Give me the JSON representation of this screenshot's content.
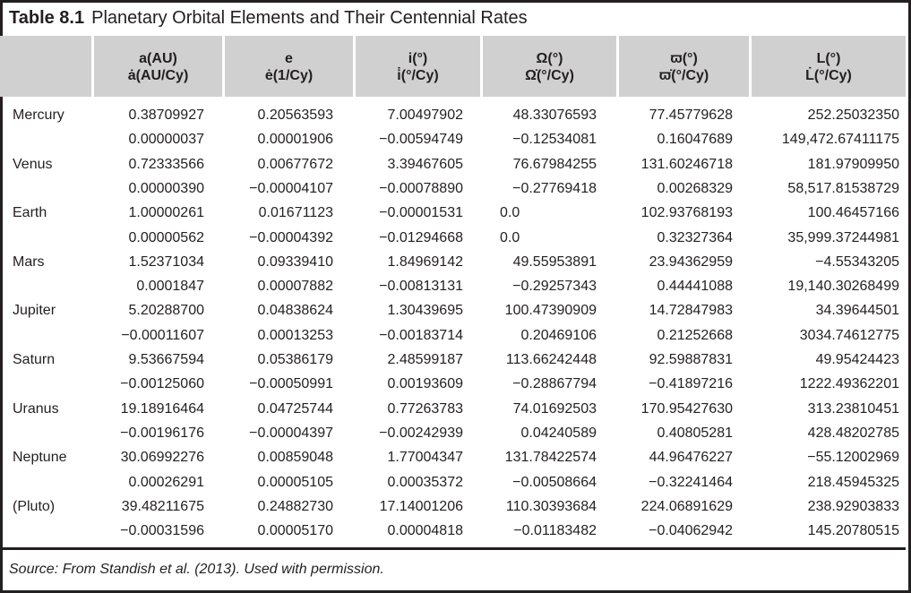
{
  "table": {
    "number": "Table 8.1",
    "caption": "Planetary Orbital Elements and Their Centennial Rates",
    "headers": [
      {
        "line1": "a(AU)",
        "line2": "ȧ(AU/Cy)"
      },
      {
        "line1": "e",
        "line2": "ė(1/Cy)"
      },
      {
        "line1": "i(°)",
        "line2": "i̇(°/Cy)"
      },
      {
        "line1": "Ω(°)",
        "line2": "Ω̇(°/Cy)"
      },
      {
        "line1": "ϖ(°)",
        "line2": "ϖ̇(°/Cy)"
      },
      {
        "line1": "L(°)",
        "line2": "L̇(°/Cy)"
      }
    ],
    "rows": [
      {
        "name": "Mercury",
        "elements": [
          "0.38709927",
          "0.20563593",
          "7.00497902",
          "48.33076593",
          "77.45779628",
          "252.25032350"
        ],
        "rates": [
          "0.00000037",
          "0.00001906",
          "−0.00594749",
          "−0.12534081",
          "0.16047689",
          "149,472.67411175"
        ]
      },
      {
        "name": "Venus",
        "elements": [
          "0.72333566",
          "0.00677672",
          "3.39467605",
          "76.67984255",
          "131.60246718",
          "181.97909950"
        ],
        "rates": [
          "0.00000390",
          "−0.00004107",
          "−0.00078890",
          "−0.27769418",
          "0.00268329",
          "58,517.81538729"
        ]
      },
      {
        "name": "Earth",
        "elements": [
          "1.00000261",
          "0.01671123",
          "−0.00001531",
          "0.0",
          "102.93768193",
          "100.46457166"
        ],
        "rates": [
          "0.00000562",
          "−0.00004392",
          "−0.01294668",
          "0.0",
          "0.32327364",
          "35,999.37244981"
        ]
      },
      {
        "name": "Mars",
        "elements": [
          "1.52371034",
          "0.09339410",
          "1.84969142",
          "49.55953891",
          "23.94362959",
          "−4.55343205"
        ],
        "rates": [
          "0.0001847",
          "0.00007882",
          "−0.00813131",
          "−0.29257343",
          "0.44441088",
          "19,140.30268499"
        ]
      },
      {
        "name": "Jupiter",
        "elements": [
          "5.20288700",
          "0.04838624",
          "1.30439695",
          "100.47390909",
          "14.72847983",
          "34.39644501"
        ],
        "rates": [
          "−0.00011607",
          "0.00013253",
          "−0.00183714",
          "0.20469106",
          "0.21252668",
          "3034.74612775"
        ]
      },
      {
        "name": "Saturn",
        "elements": [
          "9.53667594",
          "0.05386179",
          "2.48599187",
          "113.66242448",
          "92.59887831",
          "49.95424423"
        ],
        "rates": [
          "−0.00125060",
          "−0.00050991",
          "0.00193609",
          "−0.28867794",
          "−0.41897216",
          "1222.49362201"
        ]
      },
      {
        "name": "Uranus",
        "elements": [
          "19.18916464",
          "0.04725744",
          "0.77263783",
          "74.01692503",
          "170.95427630",
          "313.23810451"
        ],
        "rates": [
          "−0.00196176",
          "−0.00004397",
          "−0.00242939",
          "0.04240589",
          "0.40805281",
          "428.48202785"
        ]
      },
      {
        "name": "Neptune",
        "elements": [
          "30.06992276",
          "0.00859048",
          "1.77004347",
          "131.78422574",
          "44.96476227",
          "−55.12002969"
        ],
        "rates": [
          "0.00026291",
          "0.00005105",
          "0.00035372",
          "−0.00508664",
          "−0.32241464",
          "218.45945325"
        ]
      },
      {
        "name": "(Pluto)",
        "elements": [
          "39.48211675",
          "0.24882730",
          "17.14001206",
          "110.30393684",
          "224.06891629",
          "238.92903833"
        ],
        "rates": [
          "−0.00031596",
          "0.00005170",
          "0.00004818",
          "−0.01183482",
          "−0.04062942",
          "145.20780515"
        ]
      }
    ],
    "source": "Source: From Standish et al. (2013). Used with permission."
  }
}
